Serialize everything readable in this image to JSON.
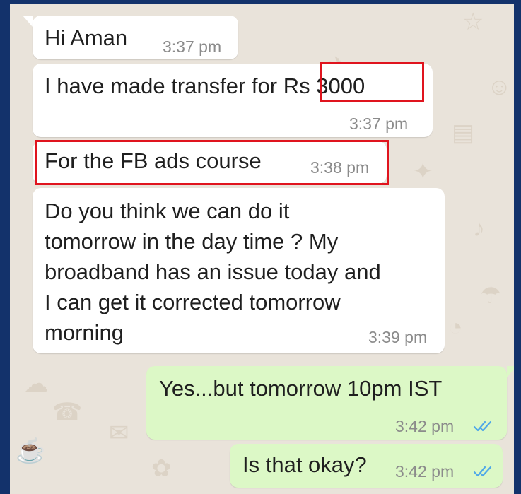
{
  "messages": [
    {
      "direction": "incoming",
      "text": "Hi Aman",
      "time": "3:37 pm"
    },
    {
      "direction": "incoming",
      "text": "I have made transfer for Rs 3000",
      "text_lead": "I have made transfer for ",
      "text_amount": "Rs 3000",
      "time": "3:37 pm"
    },
    {
      "direction": "incoming",
      "text": "For the FB ads course",
      "time": "3:38 pm"
    },
    {
      "direction": "incoming",
      "lines": [
        "Do you think we can do it",
        "tomorrow in the day time  ? My",
        "broadband has an issue today and",
        "I can get it corrected tomorrow",
        "morning"
      ],
      "time": "3:39 pm"
    },
    {
      "direction": "outgoing",
      "text": "Yes...but tomorrow 10pm IST",
      "time": "3:42 pm",
      "status": "read"
    },
    {
      "direction": "outgoing",
      "text": "Is that okay?",
      "time": "3:42 pm",
      "status": "read"
    }
  ],
  "annotations": {
    "highlight_color": "#e0141e",
    "highlighted": [
      "Rs 3000",
      "For the FB ads course"
    ]
  },
  "colors": {
    "frame_background": "#13326b",
    "chat_background": "#e9e3da",
    "incoming_bubble": "#ffffff",
    "outgoing_bubble": "#dcf8c6",
    "read_tick": "#4fa8e8"
  },
  "icons": {
    "read_receipt": "double-check-icon"
  }
}
